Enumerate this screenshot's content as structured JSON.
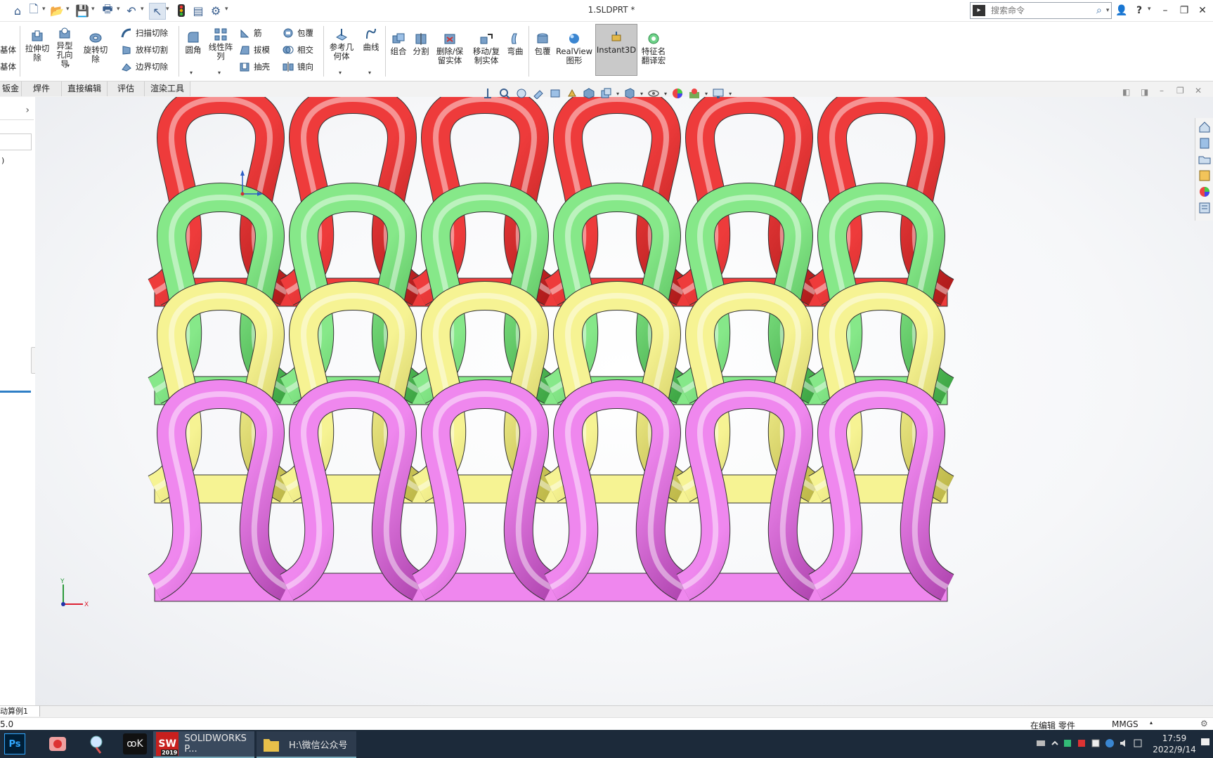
{
  "titlebar": {
    "title": "1.SLDPRT *",
    "search_placeholder": "搜索命令",
    "help": "?"
  },
  "ribbon": {
    "left_partial": [
      "基体",
      "基体"
    ],
    "extrude_cut": "拉伸切除",
    "hole_wizard": "异型孔向导",
    "revolve_cut": "旋转切除",
    "sweep_cut": "扫描切除",
    "loft_cut": "放样切割",
    "boundary_cut": "边界切除",
    "fillet": "圆角",
    "linear_pattern": "线性阵列",
    "rib": "筋",
    "draft": "拔模",
    "shell": "抽壳",
    "wrap": "包覆",
    "intersect": "相交",
    "mirror": "镜向",
    "ref_geometry": "参考几何体",
    "curves": "曲线",
    "combine": "组合",
    "split": "分割",
    "delete_keep_body": "删除/保留实体",
    "move_copy_body": "移动/复制实体",
    "flex": "弯曲",
    "wrap2": "包覆",
    "realview": "RealView图形",
    "instant3d": "Instant3D",
    "feature_translate": "特征名翻译宏"
  },
  "tabs": [
    "钣金",
    "焊件",
    "直接编辑",
    "评估",
    "渲染工具"
  ],
  "panel": {
    "paren": ")"
  },
  "bottom_tab": "动算例1",
  "status": {
    "left": "5.0",
    "editing": "在编辑 零件",
    "units": "MMGS"
  },
  "taskbar": {
    "solidworks": "SOLIDWORKS P...",
    "folder": "H:\\微信公众号",
    "time": "17:59",
    "date": "2022/9/14",
    "sw_badge": "2019"
  },
  "model": {
    "rows": [
      {
        "name": "red",
        "color": "#ee3b3b",
        "shade": "#b01c1c"
      },
      {
        "name": "green",
        "color": "#86e889",
        "shade": "#3fa745"
      },
      {
        "name": "yellow",
        "color": "#f6f393",
        "shade": "#bfb94a"
      },
      {
        "name": "pink",
        "color": "#ef87ee",
        "shade": "#b248b2"
      }
    ],
    "loops_per_row": 6
  },
  "axis": {
    "x": "X",
    "y": "Y"
  }
}
